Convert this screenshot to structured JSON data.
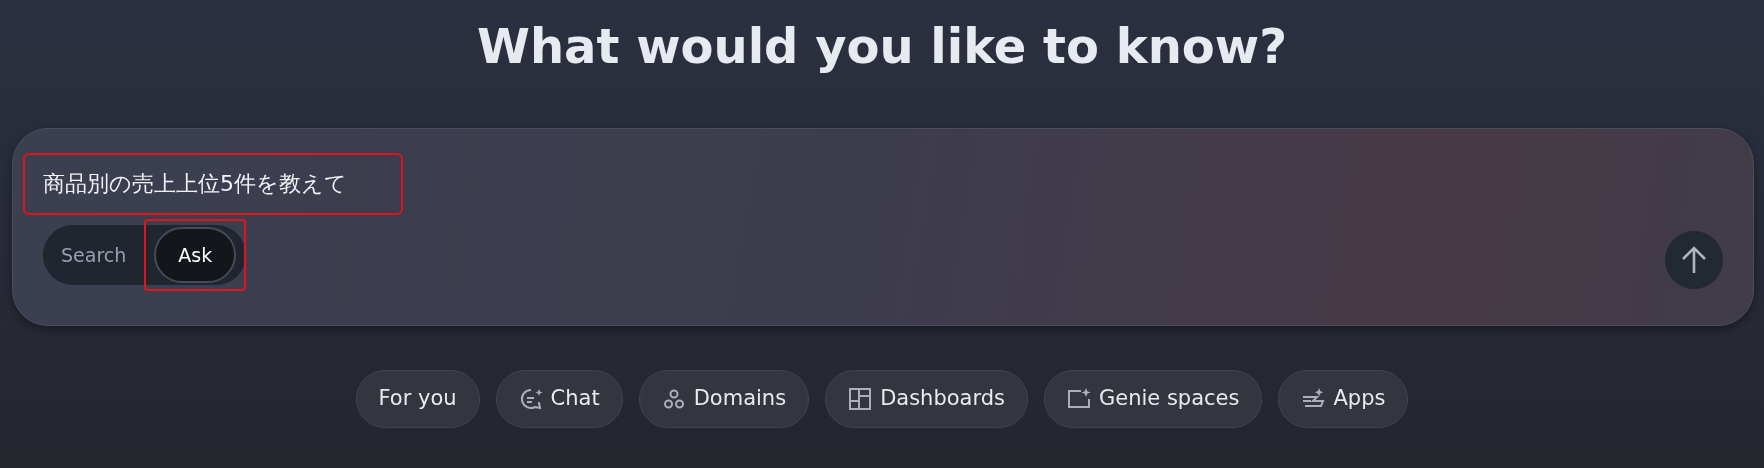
{
  "heading": "What would you like to know?",
  "query": {
    "value": "商品別の売上上位5件を教えて",
    "highlighted": true
  },
  "modes": [
    {
      "label": "Search",
      "selected": false,
      "highlighted": false
    },
    {
      "label": "Ask",
      "selected": true,
      "highlighted": true
    }
  ],
  "send_button": {
    "disabled": false
  },
  "chips": [
    {
      "label": "For you"
    },
    {
      "label": "Chat"
    },
    {
      "label": "Domains"
    },
    {
      "label": "Dashboards"
    },
    {
      "label": "Genie spaces"
    },
    {
      "label": "Apps"
    }
  ]
}
